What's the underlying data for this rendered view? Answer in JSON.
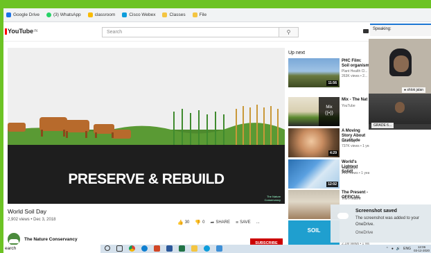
{
  "bookmarks": [
    {
      "label": "Google Drive",
      "color": "#1a73e8"
    },
    {
      "label": "(3) WhatsApp",
      "color": "#25d366"
    },
    {
      "label": "classroom",
      "color": "#f9bb00"
    },
    {
      "label": "Cisco Webex",
      "color": "#0d9ddb"
    },
    {
      "label": "Classes",
      "color": "#f4c542"
    },
    {
      "label": "File",
      "color": "#f4c542"
    }
  ],
  "youtube": {
    "logo_text": "YouTube",
    "logo_sup": "IN",
    "search_placeholder": "Search"
  },
  "webex": {
    "speaking_label": "Speaking:",
    "participant1": "shlok jalan",
    "participant2": "GRADE 6..."
  },
  "video": {
    "overlay_title": "PRESERVE & REBUILD",
    "channel_watermark": "The Nature Conservancy",
    "title": "World Soil Day",
    "meta": "2,902 views • Dec 3, 2018",
    "likes": "30",
    "dislikes": "0",
    "share_label": "SHARE",
    "save_label": "SAVE",
    "more_label": "...",
    "channel_name": "The Nature Conservancy",
    "subscribe_label": "SUBSCRIBE"
  },
  "up_next_label": "Up next",
  "suggestions": [
    {
      "title": "PHC Film: Soil organism",
      "channel": "Plant Health Cl...",
      "meta": "263K views • 2...",
      "duration": "11:56"
    },
    {
      "title": "Mix - The Nat",
      "channel": "YouTube",
      "meta": "",
      "duration": "",
      "mix_label": "Mix"
    },
    {
      "title": "A Moving Story About Gratitude",
      "channel": "Meir Kay",
      "meta": "737K views • 1 year ago",
      "duration": "4:29"
    },
    {
      "title": "World's Lightest Solid!",
      "channel": "Veritasium",
      "meta": "24M views • 1 year ago",
      "duration": "12:02"
    },
    {
      "title": "The Present - OFFICIAL",
      "channel": "The Present",
      "meta": "",
      "duration": ""
    },
    {
      "title": "",
      "channel": "",
      "meta": "2.1M views • 1 year ago",
      "duration": "",
      "thumb_text": "SOIL"
    }
  ],
  "toast": {
    "title": "Screenshot saved",
    "body": "The screenshot was added to your OneDrive.",
    "source": "OneDrive"
  },
  "taskbar": {
    "search_text": "earch",
    "lang": "ENG",
    "time": "12:06",
    "date": "03-12-2020"
  }
}
